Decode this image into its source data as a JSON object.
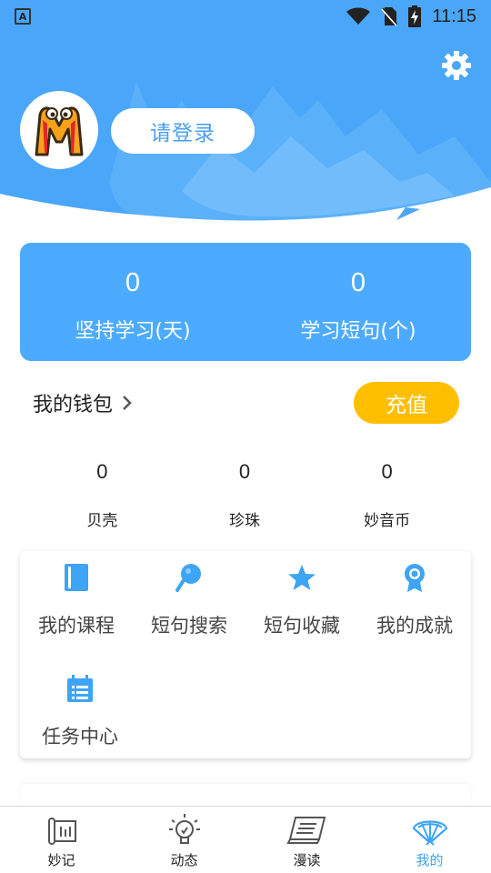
{
  "status_bar": {
    "app_badge": "A",
    "time": "11:15"
  },
  "header": {
    "login_label": "请登录"
  },
  "stats": [
    {
      "value": "0",
      "label": "坚持学习(天)"
    },
    {
      "value": "0",
      "label": "学习短句(个)"
    }
  ],
  "wallet": {
    "title": "我的钱包",
    "recharge_label": "充值",
    "currencies": [
      {
        "value": "0",
        "label": "贝壳"
      },
      {
        "value": "0",
        "label": "珍珠"
      },
      {
        "value": "0",
        "label": "妙音币"
      }
    ]
  },
  "features": [
    {
      "label": "我的课程",
      "icon": "book-icon"
    },
    {
      "label": "短句搜索",
      "icon": "search-icon"
    },
    {
      "label": "短句收藏",
      "icon": "star-icon"
    },
    {
      "label": "我的成就",
      "icon": "medal-icon"
    },
    {
      "label": "任务中心",
      "icon": "calendar-icon"
    }
  ],
  "bottom_nav": [
    {
      "label": "妙记",
      "icon": "scroll-icon"
    },
    {
      "label": "动态",
      "icon": "lightbulb-icon"
    },
    {
      "label": "漫读",
      "icon": "book-open-icon"
    },
    {
      "label": "我的",
      "icon": "fan-icon",
      "active": true
    }
  ],
  "colors": {
    "primary": "#4cabff",
    "header_bg": "#4aa6f8",
    "accent": "#ffbf00",
    "active_nav": "#3ea4f5"
  }
}
